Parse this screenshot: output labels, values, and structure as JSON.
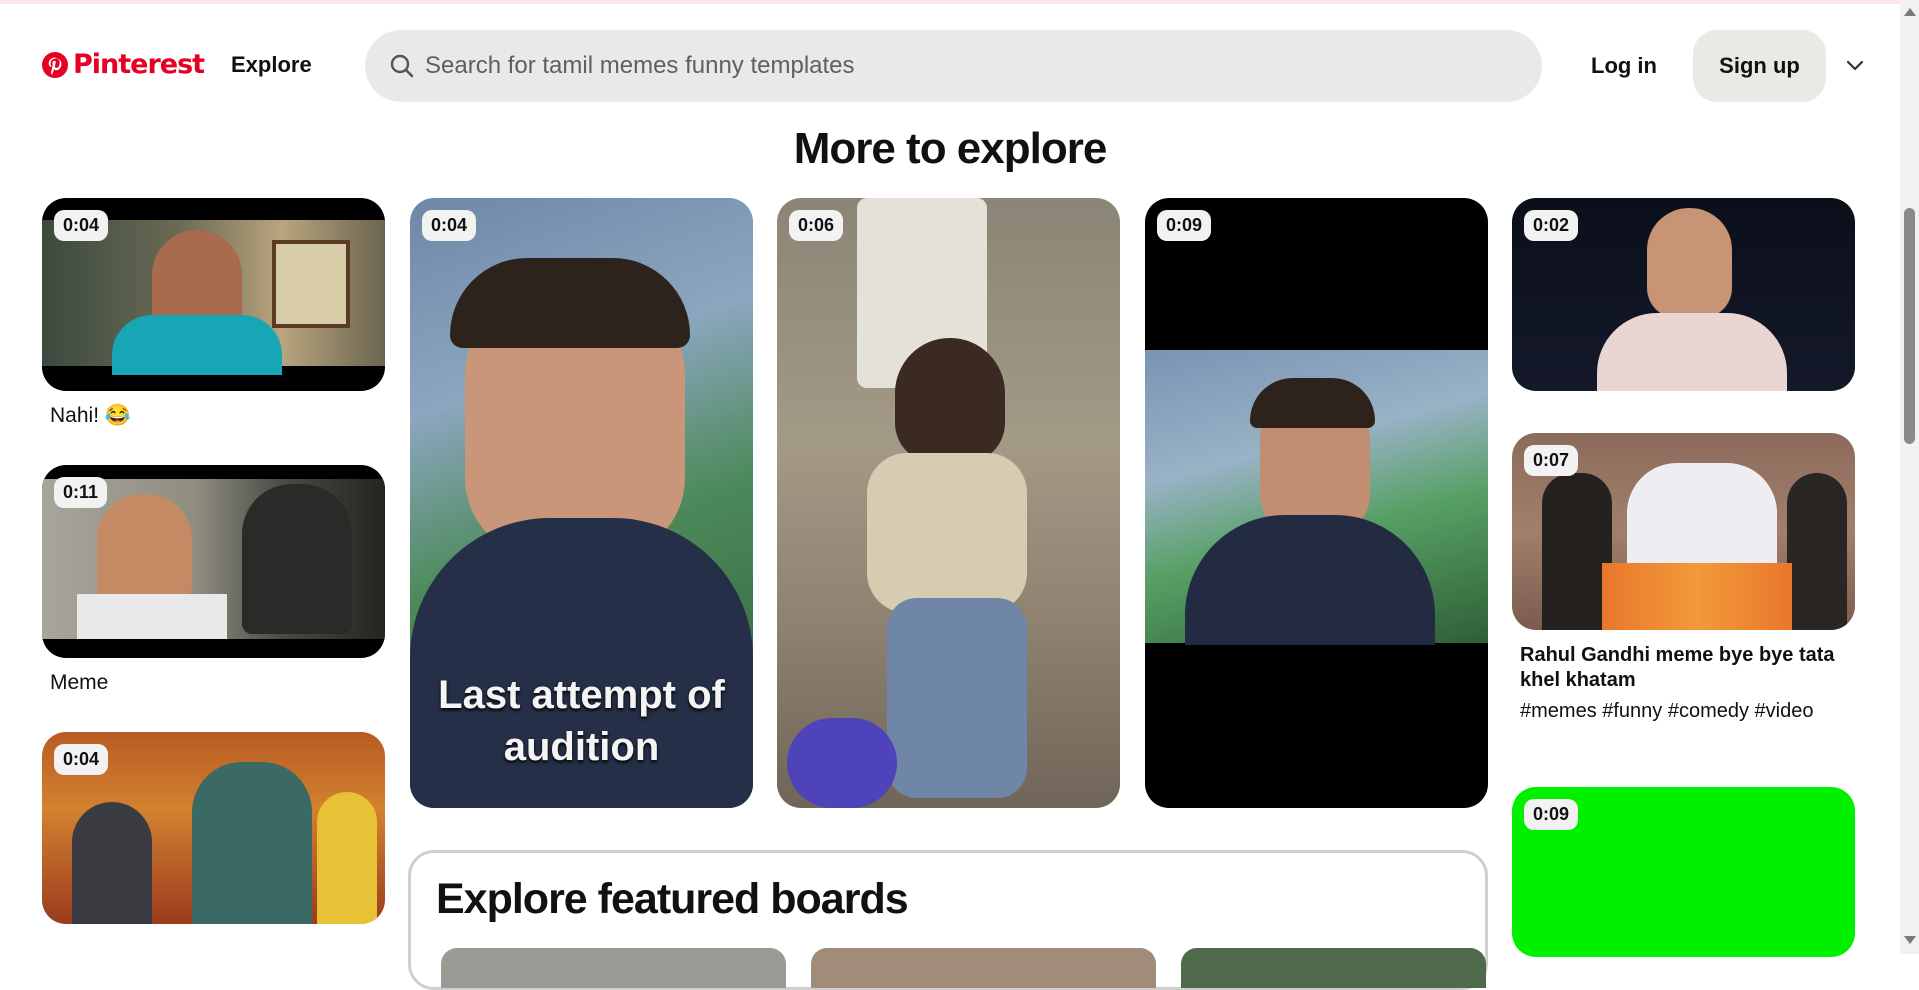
{
  "header": {
    "brand": "Pinterest",
    "nav_explore": "Explore",
    "search_placeholder": "Search for",
    "search_query": "tamil memes funny templates",
    "login_label": "Log in",
    "signup_label": "Sign up"
  },
  "section_title": "More to explore",
  "pins": {
    "p1": {
      "duration": "0:04",
      "caption": "Nahi! 😂"
    },
    "p2": {
      "duration": "0:11",
      "caption": "Meme"
    },
    "p3": {
      "duration": "0:04"
    },
    "p4": {
      "duration": "0:04",
      "overlay_line1": "Last attempt of",
      "overlay_line2": "audition"
    },
    "p5": {
      "duration": "0:06"
    },
    "p6": {
      "duration": "0:09"
    },
    "p7": {
      "duration": "0:02"
    },
    "p8": {
      "duration": "0:07",
      "title": "Rahul Gandhi meme bye bye tata khel khatam",
      "tags": "#memes #funny #comedy #video"
    },
    "p9": {
      "duration": "0:09"
    }
  },
  "featured_boards_title": "Explore featured boards",
  "colors": {
    "brand": "#e60023",
    "search_bg": "#e9e9e9",
    "green_screen": "#00f000"
  },
  "icons": [
    "pinterest-logo-icon",
    "search-icon",
    "chevron-down-icon"
  ]
}
